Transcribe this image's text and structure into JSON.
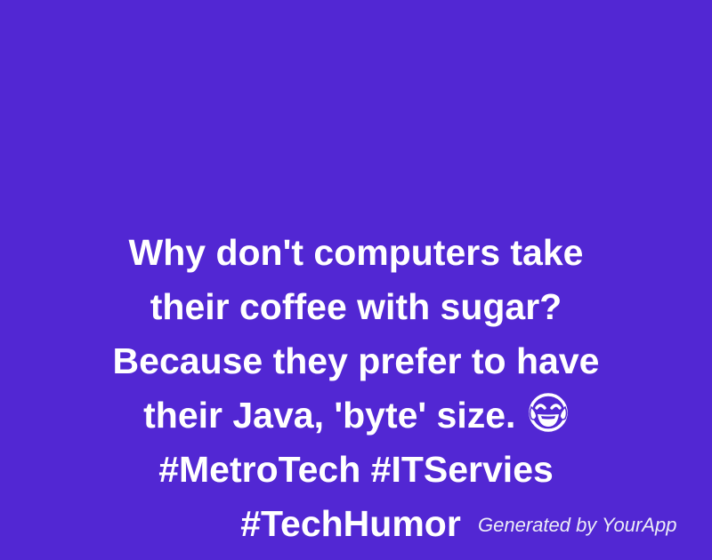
{
  "joke": {
    "line1": "Why don't computers take",
    "line2": "their coffee with sugar?",
    "line3": "Because they prefer to have",
    "line4": "their Java, 'byte' size.",
    "emoji": "face-with-tears-of-joy-icon",
    "line5": "#MetroTech #ITServies",
    "line6": "#TechHumor"
  },
  "watermark": {
    "text": "Generated by YourApp"
  },
  "colors": {
    "background": "#5227d3",
    "text": "#ffffff"
  }
}
